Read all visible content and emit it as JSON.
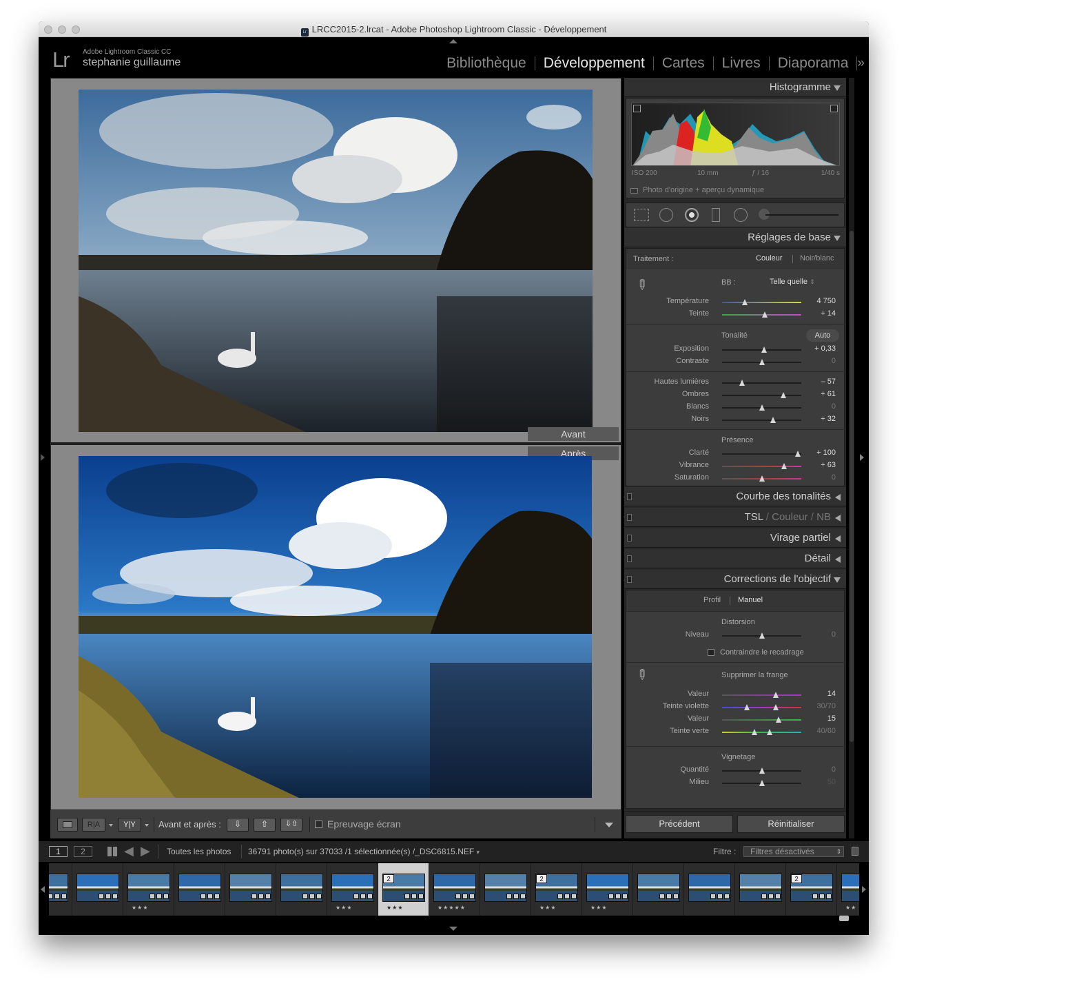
{
  "window": {
    "title": "LRCC2015-2.lrcat - Adobe Photoshop Lightroom Classic - Développement",
    "app_icon": "Lr"
  },
  "identity": {
    "logo": "Lr",
    "product": "Adobe Lightroom Classic CC",
    "user": "stephanie guillaume"
  },
  "modules": [
    {
      "label": "Bibliothèque",
      "active": false
    },
    {
      "label": "Développement",
      "active": true
    },
    {
      "label": "Cartes",
      "active": false
    },
    {
      "label": "Livres",
      "active": false
    },
    {
      "label": "Diaporama",
      "active": false
    }
  ],
  "modules_more": "»",
  "view": {
    "before_label": "Avant",
    "after_label": "Après"
  },
  "toolbar": {
    "ra_label": "R|A",
    "yy_label": "Y|Y",
    "before_after_label": "Avant et après :",
    "proofing_label": "Epreuvage écran"
  },
  "histogram": {
    "title": "Histogramme",
    "iso": "ISO 200",
    "focal": "10 mm",
    "aperture": "ƒ / 16",
    "shutter": "1/40 s",
    "preview_label": "Photo d'origine + aperçu dynamique"
  },
  "basic": {
    "title": "Réglages de base",
    "treatment_label": "Traitement :",
    "color_opt": "Couleur",
    "bw_opt": "Noir/blanc",
    "wb_label": "BB :",
    "wb_value": "Telle quelle",
    "temp_label": "Température",
    "temp_value": "4 750",
    "temp_pos": 0.29,
    "tint_label": "Teinte",
    "tint_value": "+ 14",
    "tint_pos": 0.54,
    "tone_label": "Tonalité",
    "auto_label": "Auto",
    "exposure_label": "Exposition",
    "exposure_value": "+ 0,33",
    "exposure_pos": 0.53,
    "contrast_label": "Contraste",
    "contrast_value": "0",
    "contrast_pos": 0.5,
    "highlights_label": "Hautes lumières",
    "highlights_value": "– 57",
    "highlights_pos": 0.25,
    "shadows_label": "Ombres",
    "shadows_value": "+ 61",
    "shadows_pos": 0.77,
    "whites_label": "Blancs",
    "whites_value": "0",
    "whites_pos": 0.5,
    "blacks_label": "Noirs",
    "blacks_value": "+ 32",
    "blacks_pos": 0.64,
    "presence_label": "Présence",
    "clarity_label": "Clarté",
    "clarity_value": "+ 100",
    "clarity_pos": 0.96,
    "vibrance_label": "Vibrance",
    "vibrance_value": "+ 63",
    "vibrance_pos": 0.78,
    "saturation_label": "Saturation",
    "saturation_value": "0",
    "saturation_pos": 0.5
  },
  "collapsed": {
    "tone_curve": "Courbe des tonalités",
    "hsl": "TSL",
    "hsl_color": "Couleur",
    "hsl_bw": "NB",
    "split": "Virage partiel",
    "detail": "Détail"
  },
  "lens": {
    "title": "Corrections de l'objectif",
    "profile_tab": "Profil",
    "manual_tab": "Manuel",
    "distortion_label": "Distorsion",
    "level_label": "Niveau",
    "level_value": "0",
    "level_pos": 0.5,
    "constrain_label": "Contraindre le recadrage",
    "defringe_label": "Supprimer la frange",
    "purple_amount_label": "Valeur",
    "purple_amount_value": "14",
    "purple_amount_pos": 0.68,
    "purple_hue_label": "Teinte violette",
    "purple_hue_value": "30/70",
    "purple_hue_pos": [
      0.31,
      0.68
    ],
    "green_amount_label": "Valeur",
    "green_amount_value": "15",
    "green_amount_pos": 0.71,
    "green_hue_label": "Teinte verte",
    "green_hue_value": "40/60",
    "green_hue_pos": [
      0.41,
      0.6
    ],
    "vignette_label": "Vignetage",
    "vig_amount_label": "Quantité",
    "vig_amount_value": "0",
    "vig_amount_pos": 0.5,
    "vig_mid_label": "Milieu",
    "vig_mid_value": "50",
    "vig_mid_pos": 0.5
  },
  "buttons": {
    "previous": "Précédent",
    "reset": "Réinitialiser"
  },
  "filmstrip_bar": {
    "screen1": "1",
    "screen2": "2",
    "source": "Toutes les photos",
    "count": "36791 photo(s) sur 37033 /1 sélectionnée(s) /_DSC6815.NEF",
    "filter_label": "Filtre :",
    "filter_value": "Filtres désactivés"
  },
  "filmstrip": [
    {
      "badge": "",
      "stars": ""
    },
    {
      "badge": "",
      "stars": ""
    },
    {
      "badge": "",
      "stars": "★★★"
    },
    {
      "badge": "",
      "stars": ""
    },
    {
      "badge": "",
      "stars": ""
    },
    {
      "badge": "",
      "stars": ""
    },
    {
      "badge": "",
      "stars": "★★★"
    },
    {
      "badge": "2",
      "stars": "★★★",
      "selected": true
    },
    {
      "badge": "",
      "stars": "★★★★★"
    },
    {
      "badge": "",
      "stars": ""
    },
    {
      "badge": "2",
      "stars": "★★★"
    },
    {
      "badge": "",
      "stars": "★★★"
    },
    {
      "badge": "",
      "stars": ""
    },
    {
      "badge": "",
      "stars": ""
    },
    {
      "badge": "",
      "stars": ""
    },
    {
      "badge": "2",
      "stars": ""
    },
    {
      "badge": "",
      "stars": "★★"
    }
  ]
}
